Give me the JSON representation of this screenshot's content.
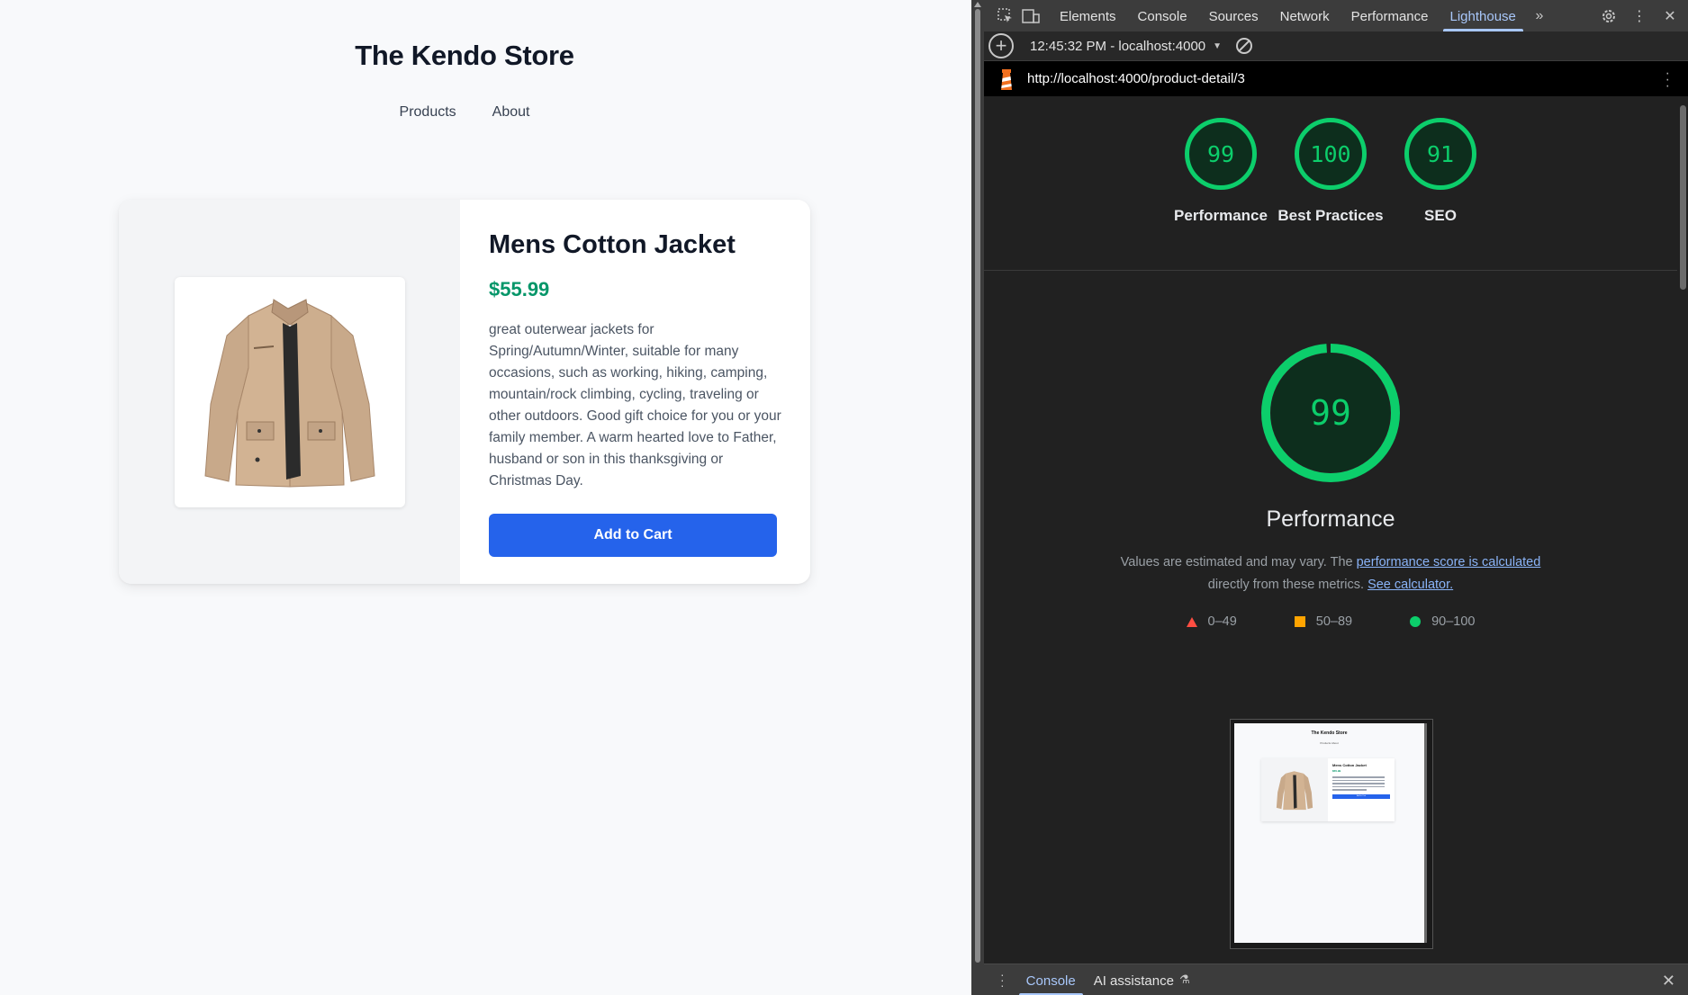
{
  "store": {
    "title": "The Kendo Store",
    "nav": [
      "Products",
      "About"
    ],
    "product": {
      "name": "Mens Cotton Jacket",
      "price": "$55.99",
      "description": "great outerwear jackets for Spring/Autumn/Winter, suitable for many occasions, such as working, hiking, camping, mountain/rock climbing, cycling, traveling or other outdoors. Good gift choice for you or your family member. A warm hearted love to Father, husband or son in this thanksgiving or Christmas Day.",
      "add_to_cart": "Add to Cart",
      "image_icon": "jacket-image"
    }
  },
  "devtools": {
    "tabs": [
      "Elements",
      "Console",
      "Sources",
      "Network",
      "Performance",
      "Lighthouse"
    ],
    "active_tab": "Lighthouse",
    "toolbar": {
      "report_label": "12:45:32 PM - localhost:4000"
    },
    "url": "http://localhost:4000/product-detail/3",
    "gauges": [
      {
        "score": "99",
        "label": "Performance"
      },
      {
        "score": "100",
        "label": "Best Practices"
      },
      {
        "score": "91",
        "label": "SEO"
      }
    ],
    "performance": {
      "score": "99",
      "score_fraction": 0.99,
      "title": "Performance",
      "desc_prefix": "Values are estimated and may vary. The ",
      "desc_link1": "performance score is calculated",
      "desc_middle": " directly from these metrics. ",
      "desc_link2": "See calculator.",
      "legend": [
        "0–49",
        "50–89",
        "90–100"
      ]
    },
    "thumbnail": {
      "title": "The Kendo Store",
      "nav": "Products    About",
      "product_name": "Mens Cotton Jacket",
      "price": "$55.99",
      "button": "Add to Cart"
    },
    "drawer": {
      "tabs": [
        "Console",
        "AI assistance"
      ],
      "active_tab": "Console"
    },
    "colors": {
      "pass": "#0cce6b",
      "average": "#ffa400",
      "fail": "#ff4e42",
      "accent": "#a8c7fa",
      "price": "#059669",
      "button": "#2563eb"
    }
  }
}
